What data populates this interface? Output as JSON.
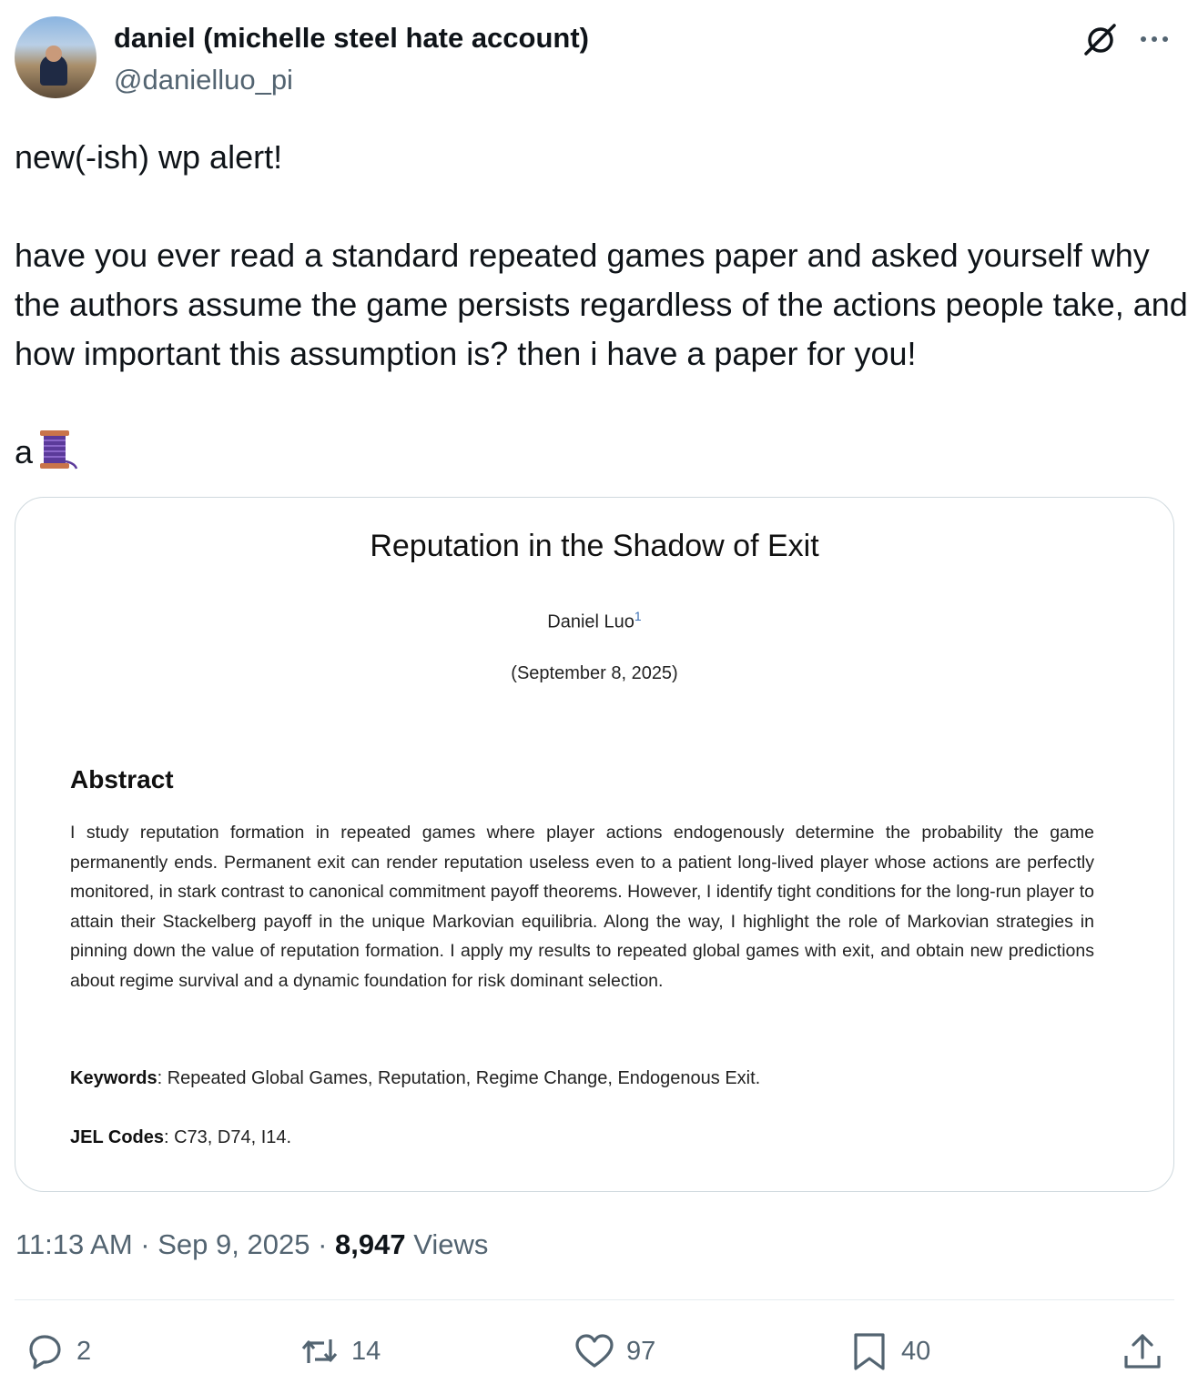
{
  "author": {
    "display_name": "daniel (michelle steel hate account)",
    "handle": "@danielluo_pi"
  },
  "tweet": {
    "text": "new(-ish) wp alert!\n\nhave you ever read a standard repeated games paper and asked yourself why the authors assume the game persists regardless of the actions people take, and how important this assumption is? then i have a paper for you!\n\na",
    "emoji_icon": "thread-spool-icon"
  },
  "paper": {
    "title": "Reputation in the Shadow of Exit",
    "author": "Daniel Luo",
    "author_footnote": "1",
    "date": "(September 8, 2025)",
    "abstract_heading": "Abstract",
    "abstract": "I study reputation formation in repeated games where player actions endogenously determine the probability the game permanently ends. Permanent exit can render reputation useless even to a patient long-lived player whose actions are perfectly monitored, in stark contrast to canonical commitment payoff theorems. However, I identify tight conditions for the long-run player to attain their Stackelberg payoff in the unique Markovian equilibria. Along the way, I highlight the role of Markovian strategies in pinning down the value of reputation formation. I apply my results to repeated global games with exit, and obtain new predictions about regime survival and a dynamic foundation for risk dominant selection.",
    "keywords_label": "Keywords",
    "keywords": ": Repeated Global Games, Reputation, Regime Change, Endogenous Exit.",
    "jel_label": "JEL Codes",
    "jel": ": C73, D74, I14."
  },
  "meta": {
    "time": "11:13 AM",
    "separator": " · ",
    "date": "Sep 9, 2025",
    "views_count": "8,947",
    "views_label": " Views"
  },
  "actions": {
    "replies": "2",
    "retweets": "14",
    "likes": "97",
    "bookmarks": "40"
  },
  "colors": {
    "text": "#0f1419",
    "secondary": "#536471",
    "border": "#cfd9de"
  }
}
